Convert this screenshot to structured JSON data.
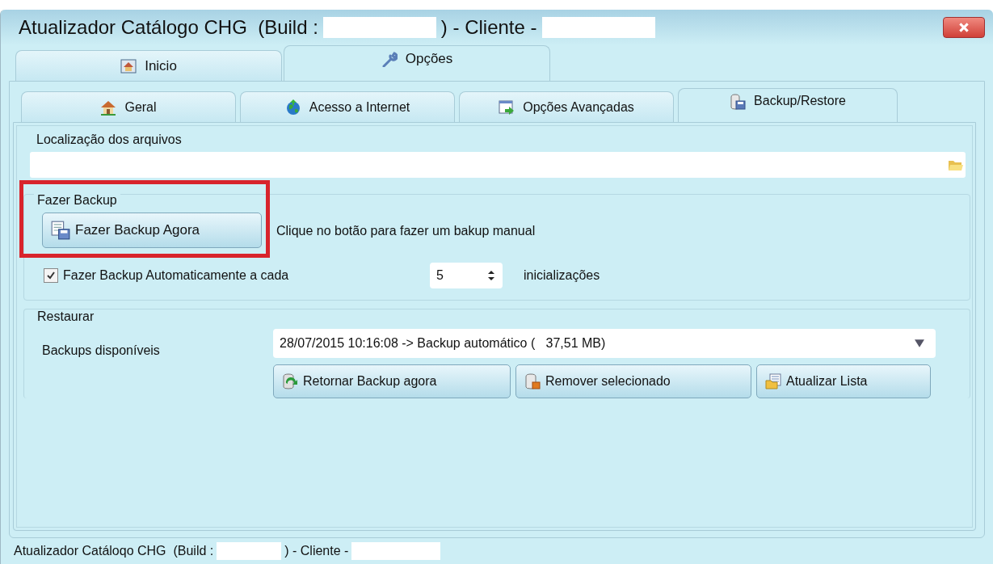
{
  "window": {
    "title": [
      "Atualizador Catálogo CHG  (Build :",
      ") - Cliente -"
    ]
  },
  "tabs": [
    {
      "label": "Inicio",
      "selected": false
    },
    {
      "label": "Opções",
      "selected": true
    }
  ],
  "subtabs": [
    {
      "label": "Geral",
      "selected": false
    },
    {
      "label": "Acesso a Internet",
      "selected": false
    },
    {
      "label": "Opções Avançadas",
      "selected": false
    },
    {
      "label": "Backup/Restore",
      "selected": true
    }
  ],
  "location_group": {
    "title": "Localização dos arquivos"
  },
  "backup_group": {
    "title": "Fazer Backup",
    "highlighted": true,
    "button": "Fazer Backup Agora",
    "hint": "Clique no botão para fazer um bakup manual",
    "auto": {
      "label": "Fazer Backup Automaticamente a cada",
      "checked": true,
      "value": "5",
      "suffix": "inicializações"
    }
  },
  "restore_group": {
    "title": "Restaurar",
    "label": "Backups disponíveis",
    "selection": "28/07/2015 10:16:08 -> Backup automático (   37,51 MB)",
    "buttons": [
      {
        "label": "Retornar Backup agora"
      },
      {
        "label": "Remover selecionado"
      },
      {
        "label": "Atualizar Lista"
      }
    ]
  },
  "status_bar": [
    "Atualizador Catáloqo CHG  (Build :",
    ") - Cliente -"
  ]
}
